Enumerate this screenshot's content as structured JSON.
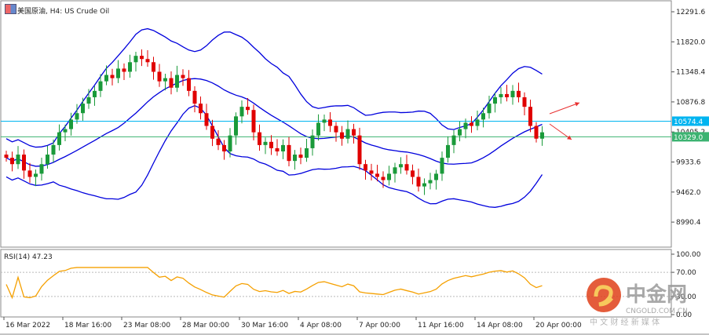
{
  "header": {
    "title": "美国原油, H4:  US Crude Oil"
  },
  "rsi": {
    "label": "RSI(14) 47.23",
    "levels": [
      100,
      70,
      30,
      0
    ],
    "level_labels": [
      "100.00",
      "70.00",
      "30.00",
      "0.00"
    ]
  },
  "watermark": {
    "brand": "中金网",
    "domain": "CNGOLD.COM.CN",
    "slogan": "中 文 财 经 新 媒 体"
  },
  "colors": {
    "bull": "#1a9a3a",
    "bear": "#e00000",
    "bands": "#0000dd",
    "rsi": "#f5a000",
    "cyan": "#00b4f0",
    "green": "#3cb371",
    "arrow": "#e83030"
  },
  "chart_data": {
    "type": "candlestick",
    "title": "美国原油, H4: US Crude Oil",
    "ylim": [
      8700,
      12450
    ],
    "y_ticks": [
      12291.6,
      11820.0,
      11348.4,
      10876.8,
      10405.2,
      9933.6,
      9462.0,
      8990.4
    ],
    "y_tick_labels": [
      "12291.6",
      "11820.0",
      "11348.4",
      "10876.8",
      "10405.2",
      "9933.6",
      "9462.0",
      "8990.4"
    ],
    "x_tick_labels": [
      "16 Mar 2022",
      "18 Mar 16:00",
      "23 Mar 08:00",
      "28 Mar 00:00",
      "30 Mar 16:00",
      "4 Apr 08:00",
      "7 Apr 00:00",
      "11 Apr 16:00",
      "14 Apr 08:00",
      "20 Apr 00:00"
    ],
    "x_tick_index": [
      0,
      10,
      20,
      30,
      40,
      50,
      60,
      70,
      80,
      90
    ],
    "closes": [
      10000,
      9900,
      10050,
      9800,
      9700,
      9750,
      9900,
      10050,
      10200,
      10400,
      10450,
      10600,
      10700,
      10850,
      10950,
      11050,
      11200,
      11300,
      11250,
      11400,
      11350,
      11500,
      11600,
      11550,
      11500,
      11350,
      11200,
      11250,
      11100,
      11300,
      11250,
      11050,
      10850,
      10700,
      10500,
      10300,
      10200,
      10100,
      10350,
      10650,
      10800,
      10750,
      10400,
      10200,
      10250,
      10150,
      10100,
      10200,
      9950,
      10050,
      10000,
      10150,
      10350,
      10550,
      10600,
      10500,
      10400,
      10300,
      10450,
      10350,
      9900,
      9800,
      9750,
      9700,
      9650,
      9750,
      9850,
      9900,
      9800,
      9700,
      9550,
      9600,
      9650,
      9750,
      10000,
      10200,
      10350,
      10450,
      10550,
      10500,
      10600,
      10700,
      10850,
      10950,
      11000,
      10950,
      11050,
      10950,
      10800,
      10500,
      10300,
      10400
    ],
    "bollinger": {
      "period": 20,
      "deviation": 2
    },
    "hlines": [
      {
        "value": 10574.4,
        "label": "10574.4",
        "color": "#00b4f0"
      },
      {
        "value": 10329.0,
        "label": "10329.0",
        "color": "#3cb371"
      }
    ],
    "rsi_period": 14
  }
}
